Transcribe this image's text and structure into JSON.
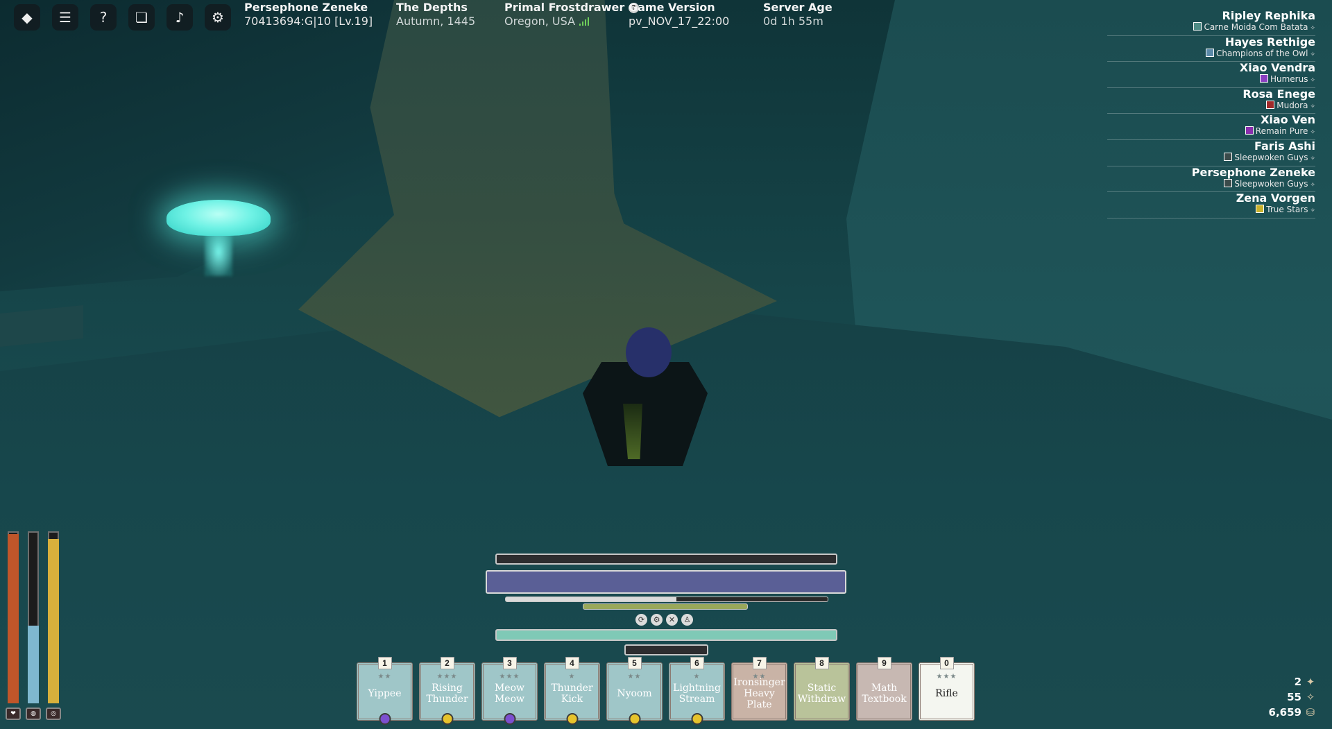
{
  "top_icons": [
    {
      "name": "roblox-logo-icon",
      "glyph": "◆"
    },
    {
      "name": "chat-icon",
      "glyph": "☰"
    },
    {
      "name": "help-icon",
      "glyph": "?"
    },
    {
      "name": "journal-icon",
      "glyph": "❏"
    },
    {
      "name": "music-icon",
      "glyph": "♪"
    },
    {
      "name": "settings-icon",
      "glyph": "⚙"
    }
  ],
  "player": {
    "name": "Persephone Zeneke",
    "id_line": "70413694:G|10 [Lv.19]"
  },
  "location": {
    "area": "The Depths",
    "season": "Autumn, 1445"
  },
  "server": {
    "name": "Primal Frostdrawer",
    "region": "Oregon, USA"
  },
  "version": {
    "label": "Game Version",
    "value": "pv_NOV_17_22:00"
  },
  "server_age": {
    "label": "Server Age",
    "value": "0d 1h 55m"
  },
  "player_list": [
    {
      "name": "Ripley Rephika",
      "guild": "Carne Moida Com Batata",
      "icon_color": "#4e8c86"
    },
    {
      "name": "Hayes Rethige",
      "guild": "Champions of the Owl",
      "icon_color": "#5a89a8"
    },
    {
      "name": "Xiao Vendra",
      "guild": "Humerus",
      "icon_color": "#8a3fc2"
    },
    {
      "name": "Rosa Enege",
      "guild": "Mudora",
      "icon_color": "#a02a2a"
    },
    {
      "name": "Xiao Ven",
      "guild": "Remain Pure",
      "icon_color": "#8a2fae"
    },
    {
      "name": "Faris Ashi",
      "guild": "Sleepwoken Guys",
      "icon_color": "#3a4a4a"
    },
    {
      "name": "Persephone Zeneke",
      "guild": "Sleepwoken Guys",
      "icon_color": "#3a4a4a"
    },
    {
      "name": "Zena Vorgen",
      "guild": "True Stars",
      "icon_color": "#c9b12c"
    }
  ],
  "stat_bars": [
    {
      "name": "health-bar",
      "level": 1.0,
      "color": "#c0562a",
      "badge": "❤"
    },
    {
      "name": "stamina-bar",
      "level": 0.46,
      "color": "#7fb8cf",
      "badge": "◍"
    },
    {
      "name": "hunger-bar",
      "level": 0.97,
      "color": "#d7b03c",
      "badge": "◎"
    }
  ],
  "hud_buttons": [
    "⟳",
    "⚙",
    "✕",
    "♙"
  ],
  "hotbar": [
    {
      "key": "1",
      "label": "Yippee",
      "stars": "★★",
      "bg": "#9fc6c8",
      "orb": "#7c4fd0"
    },
    {
      "key": "2",
      "label": "Rising Thunder",
      "stars": "★★★",
      "bg": "#9fc6c8",
      "orb": "#e6c32c"
    },
    {
      "key": "3",
      "label": "Meow Meow",
      "stars": "★★★",
      "bg": "#9fc6c8",
      "orb": "#7c4fd0"
    },
    {
      "key": "4",
      "label": "Thunder Kick",
      "stars": "★",
      "bg": "#9fc6c8",
      "orb": "#e6c32c"
    },
    {
      "key": "5",
      "label": "Nyoom",
      "stars": "★★",
      "bg": "#9fc6c8",
      "orb": "#e6c32c"
    },
    {
      "key": "6",
      "label": "Lightning Stream",
      "stars": "★",
      "bg": "#9fc6c8",
      "orb": "#e6c32c"
    },
    {
      "key": "7",
      "label": "Ironsinger Heavy Plate",
      "stars": "★★",
      "bg": "#c9b3a6",
      "orb": ""
    },
    {
      "key": "8",
      "label": "Static Withdraw",
      "stars": "",
      "bg": "#b9c39a",
      "orb": ""
    },
    {
      "key": "9",
      "label": "Math Textbook",
      "stars": "",
      "bg": "#c7b8b2",
      "orb": ""
    },
    {
      "key": "0",
      "label": "Rifle",
      "stars": "★★★",
      "bg": "#f4f6f0",
      "orb": ""
    }
  ],
  "currency": [
    {
      "value": "2",
      "icon": "notes-icon",
      "glyph": "✦"
    },
    {
      "value": "55",
      "icon": "insight-icon",
      "glyph": "✧"
    },
    {
      "value": "6,659",
      "icon": "coin-icon",
      "glyph": "⛁"
    }
  ]
}
